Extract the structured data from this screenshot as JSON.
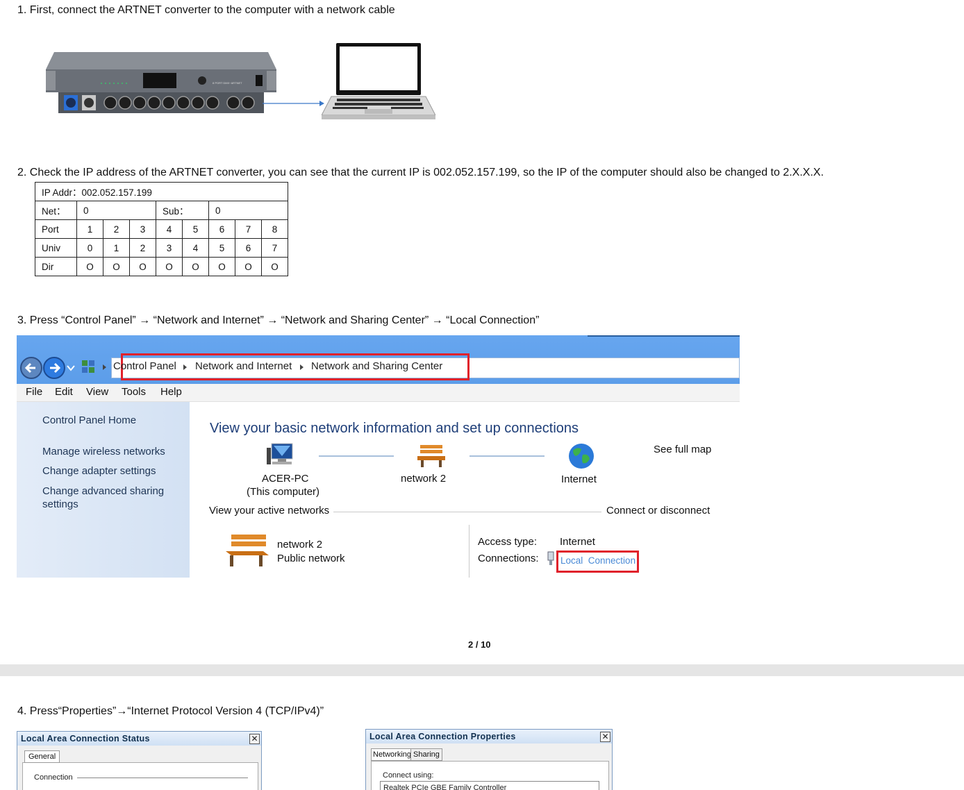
{
  "steps": {
    "s1": "1. First, connect the ARTNET converter to the computer with a network cable",
    "s2": "2. Check the IP address of the ARTNET converter, you can see that the current IP is 002.052.157.199, so the IP of the computer should also be changed to 2.X.X.X.",
    "s3": "3. Press “Control Panel” → “Network and Internet” → “Network and Sharing Center” → “Local Connection”",
    "s4": "4. Press“Properties”→“Internet Protocol Version 4 (TCP/IPv4)”"
  },
  "device": {
    "front_label": "8 PORT DMX~ARTNET"
  },
  "ip_table": {
    "ip_addr": "IP Addr：002.052.157.199",
    "net_label": "Net：",
    "net_value": "0",
    "sub_label": "Sub：",
    "sub_value": "0",
    "rows": [
      {
        "label": "Port",
        "cells": [
          "1",
          "2",
          "3",
          "4",
          "5",
          "6",
          "7",
          "8"
        ]
      },
      {
        "label": "Univ",
        "cells": [
          "0",
          "1",
          "2",
          "3",
          "4",
          "5",
          "6",
          "7"
        ]
      },
      {
        "label": "Dir",
        "cells": [
          "O",
          "O",
          "O",
          "O",
          "O",
          "O",
          "O",
          "O"
        ]
      }
    ]
  },
  "explorer": {
    "breadcrumb": [
      "Control Panel",
      "Network and Internet",
      "Network and Sharing Center"
    ],
    "menu": [
      "File",
      "Edit",
      "View",
      "Tools",
      "Help"
    ],
    "left_pane": {
      "home": "Control Panel Home",
      "links": [
        "Manage wireless networks",
        "Change adapter settings",
        "Change advanced sharing",
        "settings"
      ]
    },
    "heading": "View your basic network information and set up connections",
    "see_full_map": "See full map",
    "map": {
      "computer_name": "ACER-PC",
      "computer_sub": "(This computer)",
      "network": "network 2",
      "internet": "Internet"
    },
    "active_label": "View your active networks",
    "connect_link": "Connect or disconnect",
    "active_network": {
      "name": "network 2",
      "type": "Public network",
      "access_label": "Access type:",
      "access_value": "Internet",
      "connections_label": "Connections:",
      "connection_link": "Local  Connection"
    }
  },
  "page_number": "2 / 10",
  "dialog_status": {
    "title": "Local Area Connection  Status",
    "close": "✕",
    "tab": "General",
    "section": "Connection"
  },
  "dialog_props": {
    "title": "Local Area Connection  Properties",
    "close": "✕",
    "tabs": [
      "Networking",
      "Sharing"
    ],
    "connect_using": "Connect using:",
    "adapter": "Realtek PCIe GBE Family Controller"
  },
  "colors": {
    "accent_red": "#e0212b",
    "link_blue": "#1a62b4",
    "titlebar_blue": "#67a6ef"
  }
}
